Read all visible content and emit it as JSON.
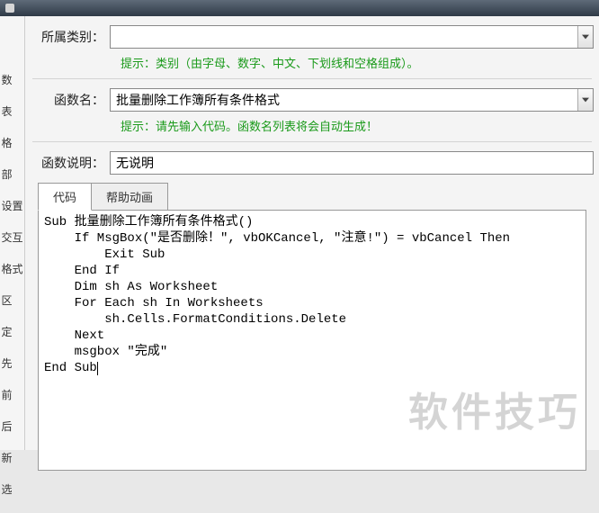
{
  "titlebar": {
    "text": ""
  },
  "leftstrip": {
    "items": [
      "数",
      "表",
      "格",
      "部",
      "设置",
      "交互",
      "格式",
      "区",
      "定",
      "先",
      "前",
      "后",
      "新",
      "选"
    ]
  },
  "form": {
    "category": {
      "label": "所属类别：",
      "value": ""
    },
    "category_hint": "提示：类别（由字母、数字、中文、下划线和空格组成）。",
    "funcname": {
      "label": "函数名：",
      "value": "批量删除工作簿所有条件格式"
    },
    "funcname_hint": "提示：请先输入代码。函数名列表将会自动生成！",
    "desc": {
      "label": "函数说明：",
      "value": "无说明"
    }
  },
  "tabs": {
    "code": "代码",
    "help": "帮助动画"
  },
  "code_lines": [
    "Sub 批量删除工作簿所有条件格式()",
    "    If MsgBox(\"是否删除！\", vbOKCancel, \"注意!\") = vbCancel Then",
    "        Exit Sub",
    "    End If",
    "    Dim sh As Worksheet",
    "    For Each sh In Worksheets",
    "        sh.Cells.FormatConditions.Delete",
    "    Next",
    "    msgbox \"完成\"",
    "End Sub"
  ],
  "watermark": "软件技巧"
}
